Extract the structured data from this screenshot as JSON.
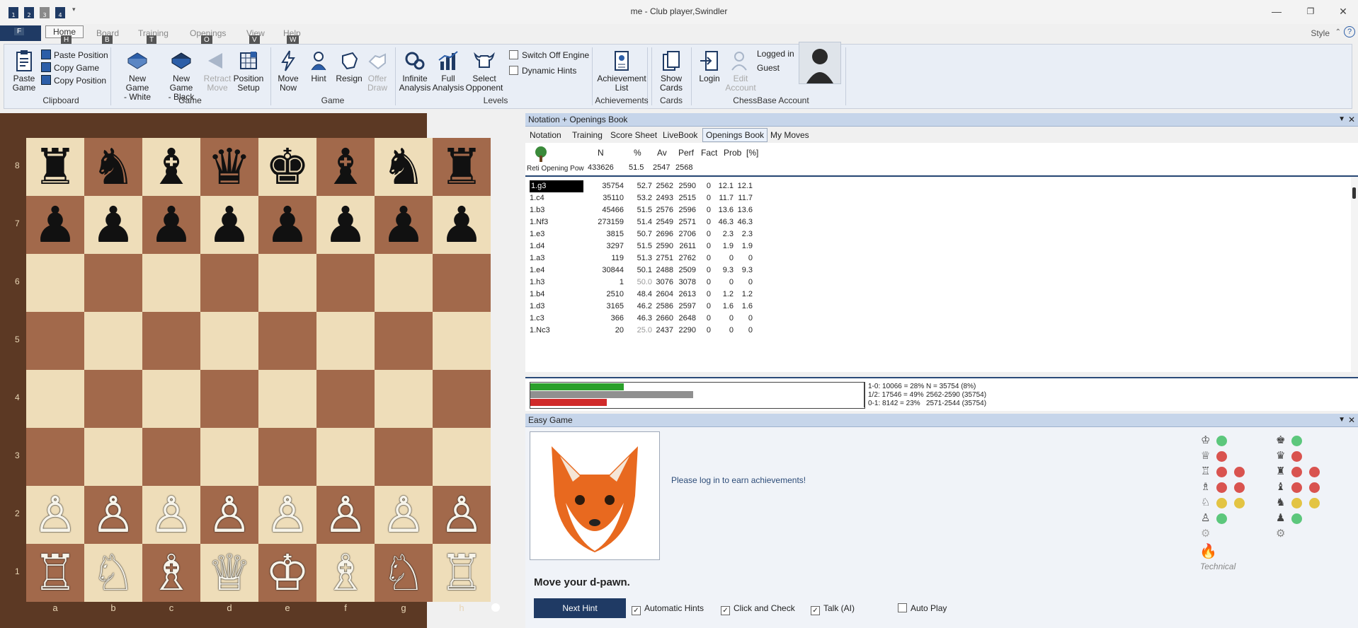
{
  "window": {
    "title": "me - Club player,Swindler",
    "style_label": "Style",
    "help": "?"
  },
  "quick_access": [
    "1",
    "2",
    "3",
    "4"
  ],
  "menu": {
    "file": "F",
    "tabs": [
      {
        "label": "Home",
        "key": "H"
      },
      {
        "label": "Board",
        "key": "B"
      },
      {
        "label": "Training",
        "key": "T"
      },
      {
        "label": "Openings",
        "key": "O"
      },
      {
        "label": "View",
        "key": "V"
      },
      {
        "label": "Help",
        "key": "W"
      }
    ]
  },
  "ribbon": {
    "clipboard": {
      "group": "Clipboard",
      "paste_game": [
        "Paste",
        "Game"
      ],
      "paste_position": "Paste Position",
      "copy_game": "Copy Game",
      "copy_position": "Copy Position"
    },
    "game": {
      "group": "Game",
      "new_white": [
        "New Game",
        "- White"
      ],
      "new_black": [
        "New Game",
        "- Black"
      ],
      "retract": [
        "Retract",
        "Move"
      ],
      "setup": [
        "Position",
        "Setup"
      ]
    },
    "game2": {
      "group": "Game",
      "move_now": [
        "Move",
        "Now"
      ],
      "hint": "Hint",
      "resign": "Resign",
      "offer_draw": [
        "Offer",
        "Draw"
      ]
    },
    "levels": {
      "group": "Levels",
      "infinite": [
        "Infinite",
        "Analysis"
      ],
      "full": [
        "Full",
        "Analysis"
      ],
      "select": [
        "Select",
        "Opponent"
      ],
      "switch_off": "Switch Off Engine",
      "dynamic_hints": "Dynamic Hints"
    },
    "achievements": {
      "group": "Achievements",
      "list": [
        "Achievement",
        "List"
      ]
    },
    "cards": {
      "group": "Cards",
      "show": [
        "Show",
        "Cards"
      ]
    },
    "account": {
      "group": "ChessBase Account",
      "login": "Login",
      "edit": [
        "Edit",
        "Account"
      ],
      "logged_in": "Logged in",
      "user": "Guest"
    }
  },
  "board": {
    "ranks": [
      "8",
      "7",
      "6",
      "5",
      "4",
      "3",
      "2",
      "1"
    ],
    "files": [
      "a",
      "b",
      "c",
      "d",
      "e",
      "f",
      "g",
      "h"
    ]
  },
  "notation_panel": {
    "title": "Notation + Openings Book",
    "tabs": [
      "Notation",
      "Training",
      "Score Sheet",
      "LiveBook",
      "Openings Book",
      "My Moves"
    ],
    "active_tab": "Openings Book",
    "columns": [
      "N",
      "%",
      "Av",
      "Perf",
      "Fact",
      "Prob",
      "[%]"
    ],
    "opening_name": "Reti Opening Pow",
    "totals": [
      "433626",
      "51.5",
      "2547",
      "2568"
    ],
    "rows": [
      {
        "move": "1.g3",
        "n": "35754",
        "pct": "52.7",
        "av": "2562",
        "perf": "2590",
        "fact": "0",
        "prob": "12.1",
        "pp": "12.1",
        "selected": true
      },
      {
        "move": "1.c4",
        "n": "35110",
        "pct": "53.2",
        "av": "2493",
        "perf": "2515",
        "fact": "0",
        "prob": "11.7",
        "pp": "11.7"
      },
      {
        "move": "1.b3",
        "n": "45466",
        "pct": "51.5",
        "av": "2576",
        "perf": "2596",
        "fact": "0",
        "prob": "13.6",
        "pp": "13.6"
      },
      {
        "move": "1.Nf3",
        "n": "273159",
        "pct": "51.4",
        "av": "2549",
        "perf": "2571",
        "fact": "0",
        "prob": "46.3",
        "pp": "46.3"
      },
      {
        "move": "1.e3",
        "n": "3815",
        "pct": "50.7",
        "av": "2696",
        "perf": "2706",
        "fact": "0",
        "prob": "2.3",
        "pp": "2.3"
      },
      {
        "move": "1.d4",
        "n": "3297",
        "pct": "51.5",
        "av": "2590",
        "perf": "2611",
        "fact": "0",
        "prob": "1.9",
        "pp": "1.9"
      },
      {
        "move": "1.a3",
        "n": "119",
        "pct": "51.3",
        "av": "2751",
        "perf": "2762",
        "fact": "0",
        "prob": "0",
        "pp": "0"
      },
      {
        "move": "1.e4",
        "n": "30844",
        "pct": "50.1",
        "av": "2488",
        "perf": "2509",
        "fact": "0",
        "prob": "9.3",
        "pp": "9.3"
      },
      {
        "move": "1.h3",
        "n": "1",
        "pct": "50.0",
        "av": "3076",
        "perf": "3078",
        "fact": "0",
        "prob": "0",
        "pp": "0",
        "dim": true
      },
      {
        "move": "1.b4",
        "n": "2510",
        "pct": "48.4",
        "av": "2604",
        "perf": "2613",
        "fact": "0",
        "prob": "1.2",
        "pp": "1.2"
      },
      {
        "move": "1.d3",
        "n": "3165",
        "pct": "46.2",
        "av": "2586",
        "perf": "2597",
        "fact": "0",
        "prob": "1.6",
        "pp": "1.6"
      },
      {
        "move": "1.c3",
        "n": "366",
        "pct": "46.3",
        "av": "2660",
        "perf": "2648",
        "fact": "0",
        "prob": "0",
        "pp": "0"
      },
      {
        "move": "1.Nc3",
        "n": "20",
        "pct": "25.0",
        "av": "2437",
        "perf": "2290",
        "fact": "0",
        "prob": "0",
        "pp": "0",
        "dim": true
      }
    ],
    "stats": {
      "win_line": "1-0: 10066 = 28%",
      "draw_line": "1/2: 17546 = 49%",
      "loss_line": "0-1: 8142 = 23%",
      "n_line": "N = 35754 (8%)",
      "range1": "2562-2590 (35754)",
      "range2": "2571-2544 (35754)",
      "win_fraction": 0.28,
      "draw_fraction": 0.49,
      "loss_fraction": 0.23,
      "colors": {
        "win": "#2aa02a",
        "draw": "#909090",
        "loss": "#d02a2a"
      }
    }
  },
  "easy_game": {
    "title": "Easy Game",
    "login_msg": "Please log in to earn achievements!",
    "hint": "Move your d-pawn.",
    "next_hint": "Next Hint",
    "automatic_hints": "Automatic Hints",
    "click_check": "Click and Check",
    "talk": "Talk (AI)",
    "auto_play": "Auto Play",
    "style": "Technical"
  }
}
